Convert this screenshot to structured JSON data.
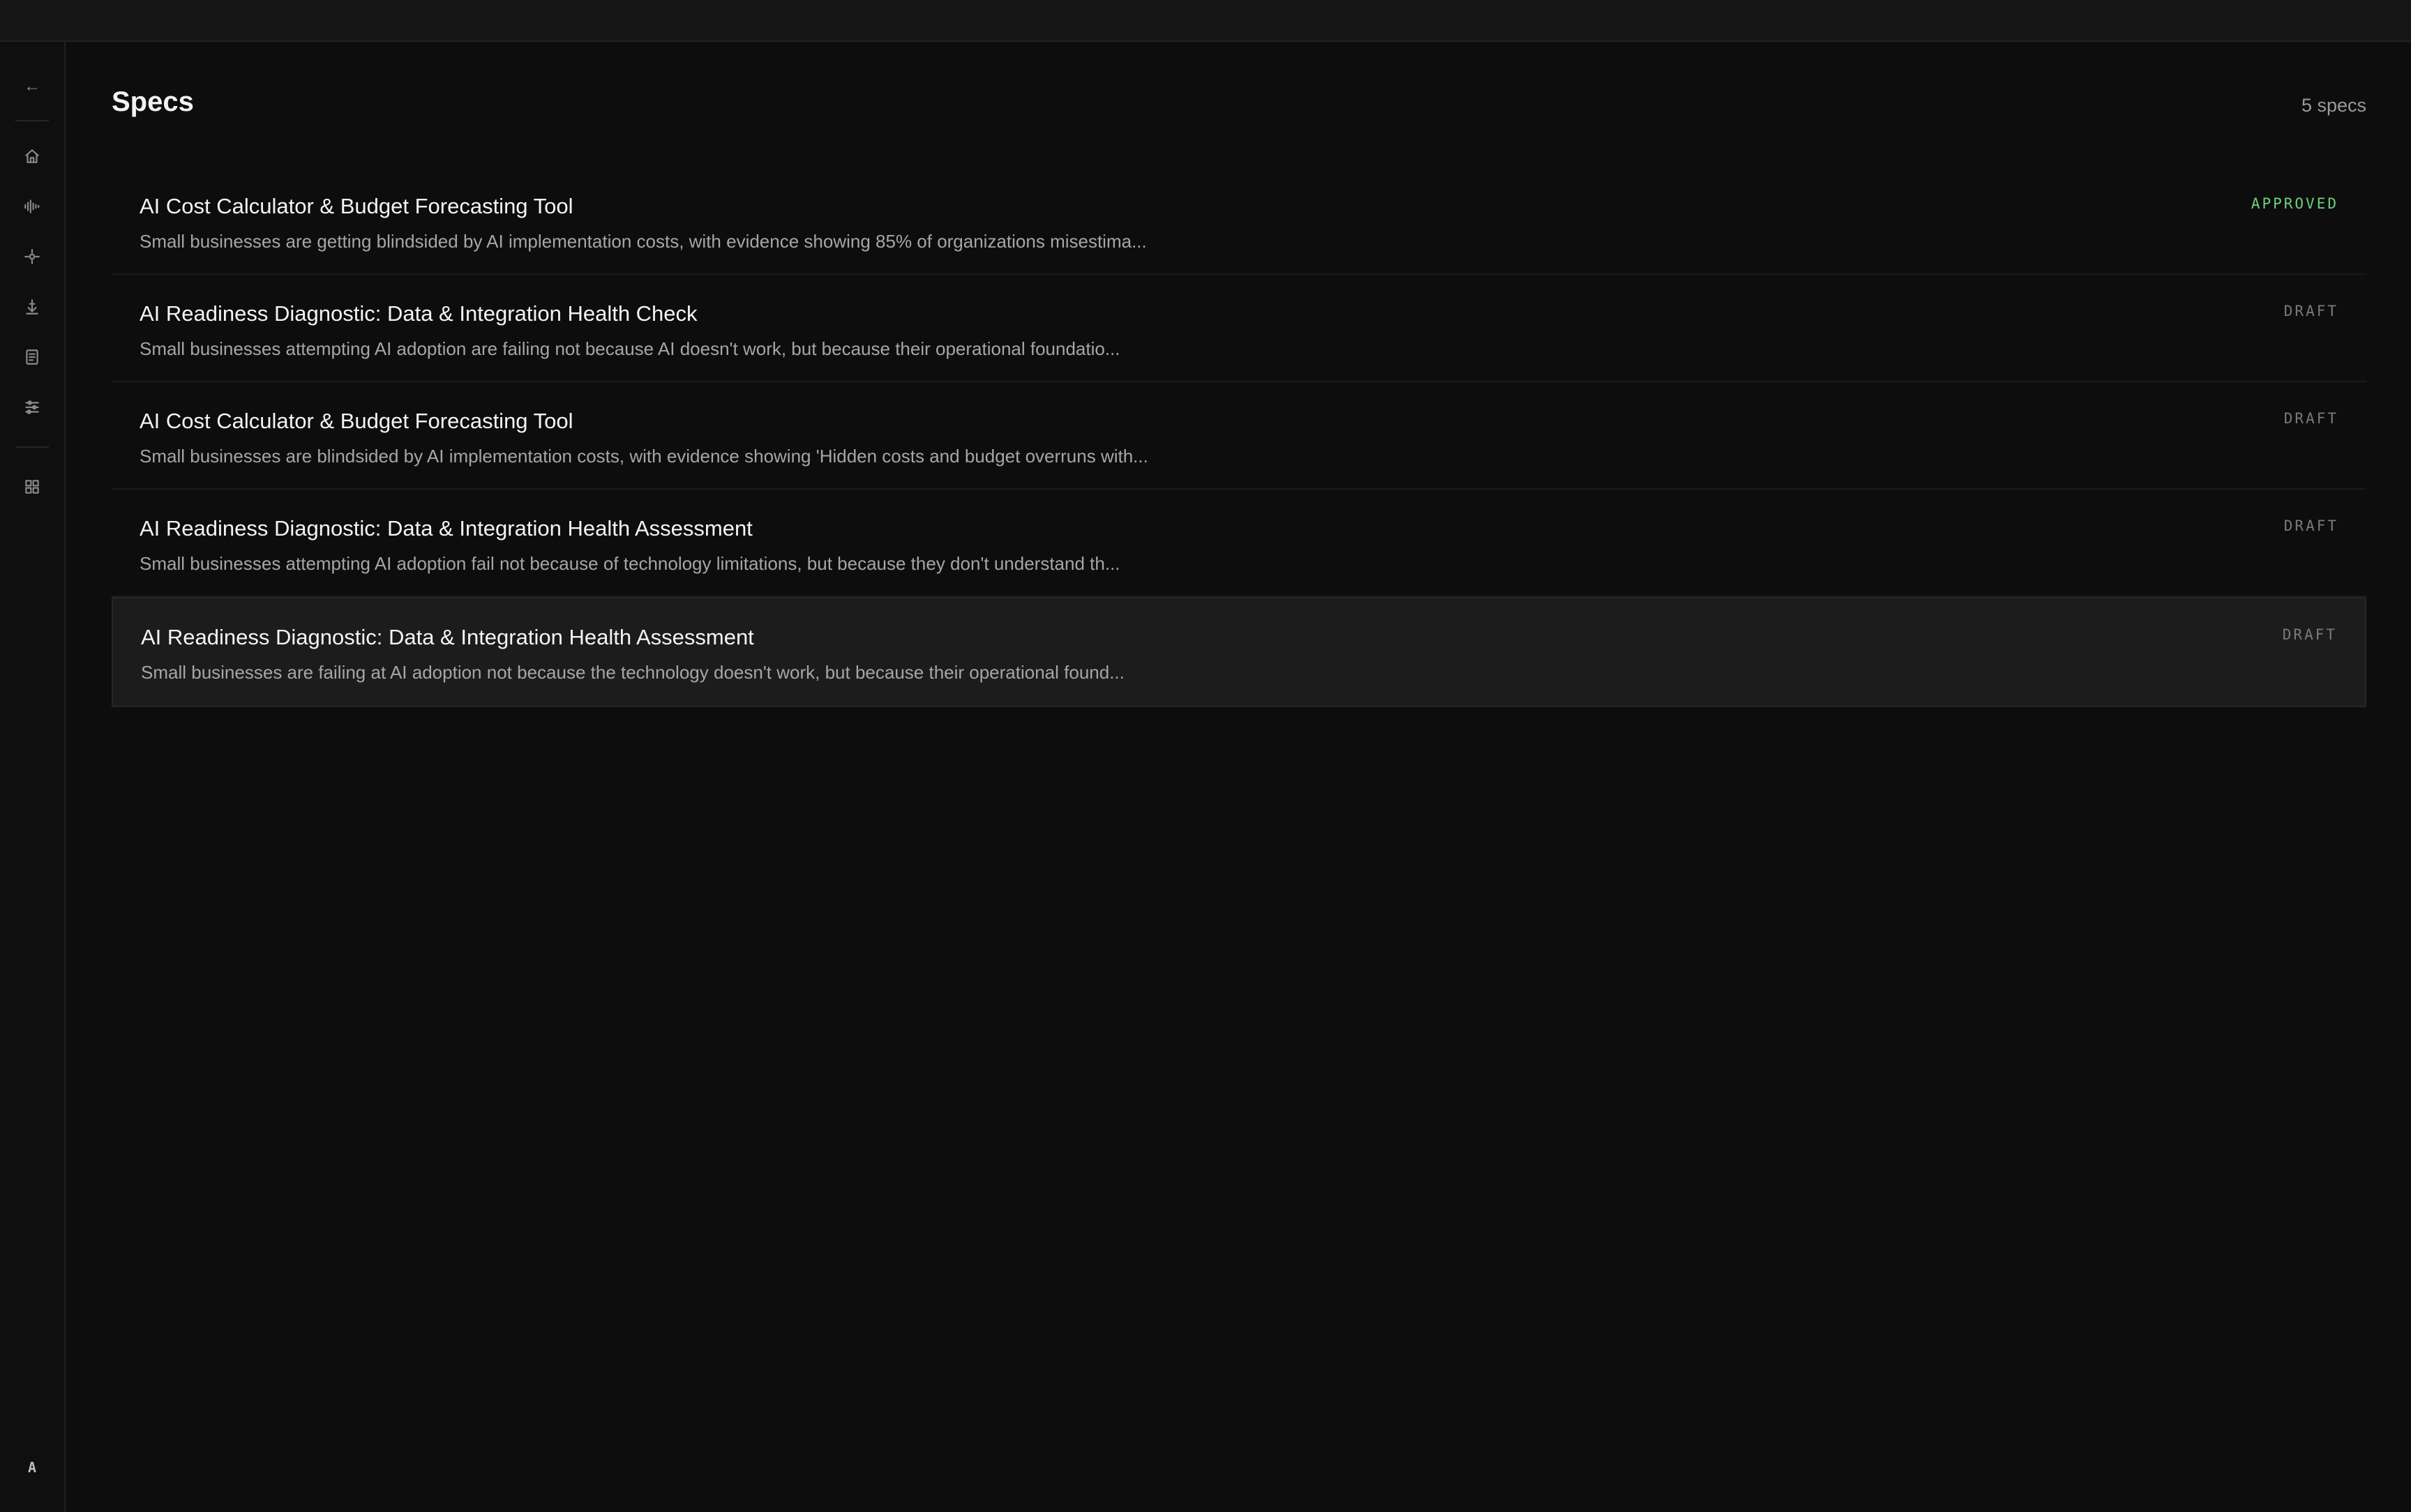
{
  "sidebar": {
    "back_label": "←",
    "nav_icons": [
      "home-icon",
      "waveform-icon",
      "crosshair-icon",
      "anchor-icon",
      "document-icon",
      "sliders-icon",
      "grid-icon"
    ],
    "avatar_initial": "A"
  },
  "header": {
    "title": "Specs",
    "count_label": "5 specs"
  },
  "specs": [
    {
      "title": "AI Cost Calculator & Budget Forecasting Tool",
      "description": "Small businesses are getting blindsided by AI implementation costs, with evidence showing 85% of organizations misestima...",
      "status": "APPROVED"
    },
    {
      "title": "AI Readiness Diagnostic: Data & Integration Health Check",
      "description": "Small businesses attempting AI adoption are failing not because AI doesn't work, but because their operational foundatio...",
      "status": "DRAFT"
    },
    {
      "title": "AI Cost Calculator & Budget Forecasting Tool",
      "description": "Small businesses are blindsided by AI implementation costs, with evidence showing 'Hidden costs and budget overruns with...",
      "status": "DRAFT"
    },
    {
      "title": "AI Readiness Diagnostic: Data & Integration Health Assessment",
      "description": "Small businesses attempting AI adoption fail not because of technology limitations, but because they don't understand th...",
      "status": "DRAFT"
    },
    {
      "title": "AI Readiness Diagnostic: Data & Integration Health Assessment",
      "description": "Small businesses are failing at AI adoption not because the technology doesn't work, but because their operational found...",
      "status": "DRAFT"
    }
  ],
  "colors": {
    "background": "#0d0d0d",
    "approved": "#6fcf7f",
    "draft": "#7a7a7a",
    "selected_row": "#1c1c1c"
  }
}
